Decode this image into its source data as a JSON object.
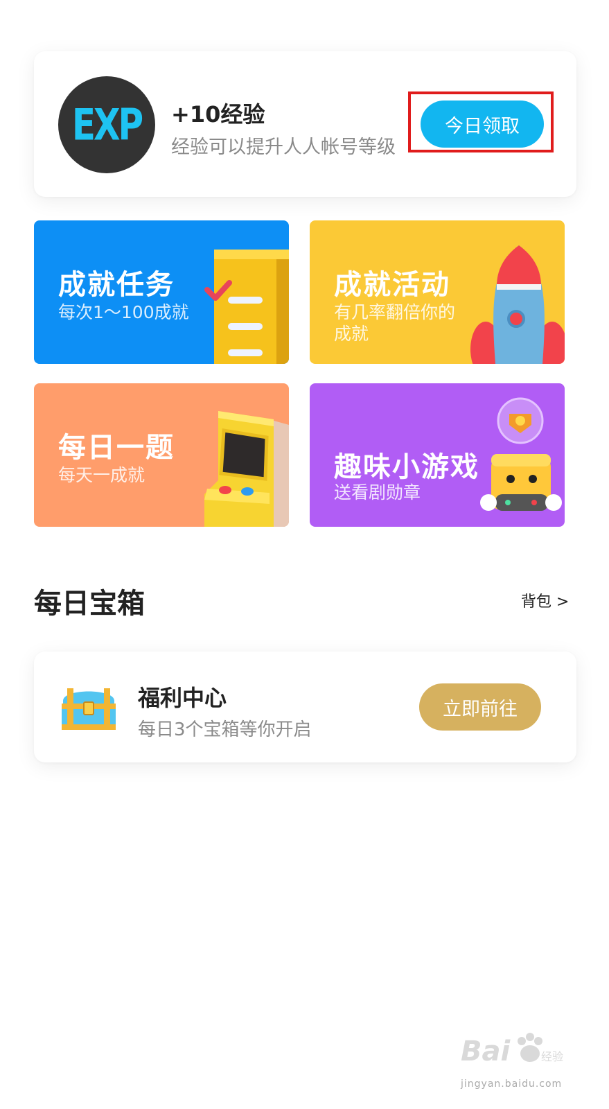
{
  "exp_card": {
    "badge_text": "EXP",
    "title": "+10经验",
    "description": "经验可以提升人人帐号等级",
    "claim_label": "今日领取"
  },
  "tiles": [
    {
      "title": "成就任务",
      "subtitle": "每次1～100成就",
      "color": "#0d8ff5"
    },
    {
      "title": "成就活动",
      "subtitle": "有几率翻倍你的\n成就",
      "color": "#fbc936"
    },
    {
      "title": "每日一题",
      "subtitle": "每天一成就",
      "color": "#ff9d6b"
    },
    {
      "title": "趣味小游戏",
      "subtitle": "送看剧勋章",
      "color": "#b15df5"
    }
  ],
  "daily_chest": {
    "section_title": "每日宝箱",
    "backpack_link": "背包 >",
    "card_title": "福利中心",
    "card_description": "每日3个宝箱等你开启",
    "go_label": "立即前往"
  },
  "watermark": {
    "brand": "Bai",
    "brand2": "经验",
    "url": "jingyan.baidu.com"
  },
  "colors": {
    "claim_button": "#12b6f0",
    "go_button": "#d6b15f",
    "highlight": "#e01c1c"
  }
}
